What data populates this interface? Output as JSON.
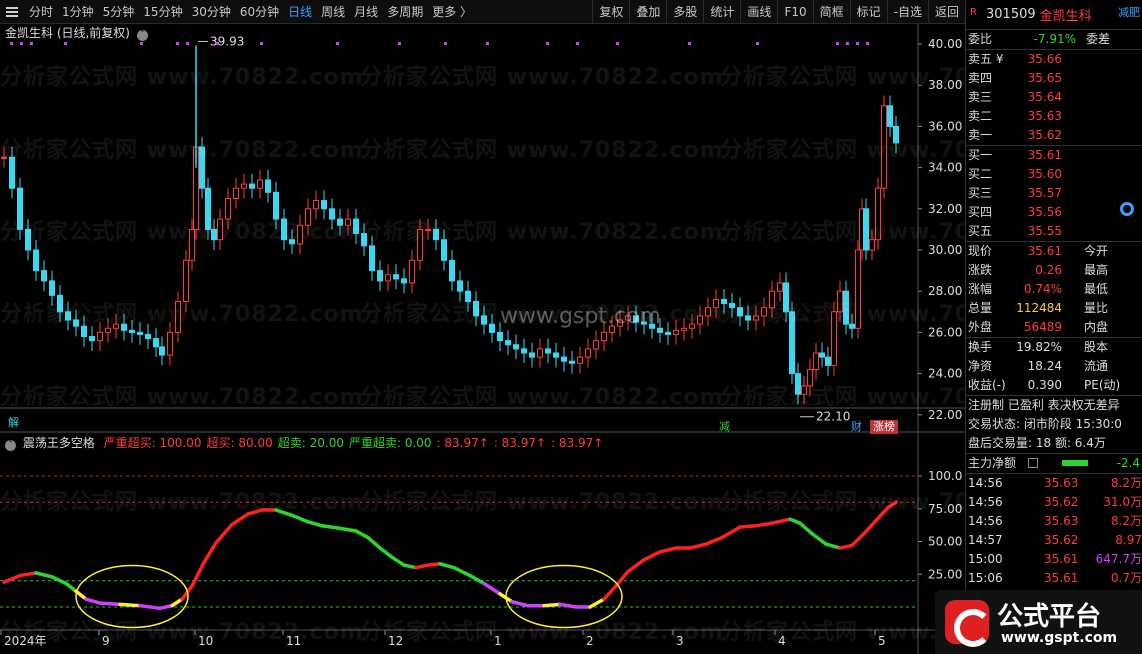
{
  "toolbar": {
    "periods": [
      "分时",
      "1分钟",
      "5分钟",
      "15分钟",
      "30分钟",
      "60分钟",
      "日线",
      "周线",
      "月线",
      "多周期",
      "更多 〉"
    ],
    "active_period": "日线",
    "actions": [
      "复权",
      "叠加",
      "多股",
      "统计",
      "画线",
      "F10",
      "简框",
      "标记",
      "-自选",
      "返回"
    ]
  },
  "main_chart": {
    "title": "金凯生科 (日线,前复权)",
    "y_ticks": [
      "40.00",
      "38.00",
      "36.00",
      "34.00",
      "32.00",
      "30.00",
      "28.00",
      "26.00",
      "24.00",
      "22.00"
    ],
    "high_label": "39.93",
    "low_label": "22.10",
    "badges": {
      "jie": "解",
      "jian": "减",
      "cai": "财",
      "zhangbang": "涨榜"
    }
  },
  "watermark": {
    "repeat_text": "分析家公式网 www.70822.com",
    "center_text": "www.gspt.com"
  },
  "oscillator": {
    "title": "震荡王多空格",
    "params": [
      {
        "label": "严重超买: 100.00",
        "color": "#ff3b3b"
      },
      {
        "label": "超买: 80.00",
        "color": "#ff3b3b"
      },
      {
        "label": "超卖: 20.00",
        "color": "#2fd52f"
      },
      {
        "label": "严重超卖: 0.00",
        "color": "#2fd52f"
      },
      {
        "label": ": 83.97↑",
        "color": "#ff3b3b"
      },
      {
        "label": ": 83.97↑",
        "color": "#ff3b3b"
      },
      {
        "label": ": 83.97↑",
        "color": "#ff3b3b"
      }
    ],
    "y_ticks": [
      "100.0",
      "75.00",
      "50.00",
      "25.00"
    ]
  },
  "x_axis": {
    "labels": [
      "2024年",
      "9",
      "10",
      "11",
      "12",
      "1",
      "2",
      "3",
      "4",
      "5"
    ]
  },
  "panel": {
    "code": "301509",
    "name": "金凯生科",
    "r_tag": "R",
    "corner_tag": "减肥",
    "webi": {
      "label": "委比",
      "value": "-7.91%",
      "label2": "委差"
    },
    "asks": [
      {
        "label": "卖五 ¥",
        "price": "35.66"
      },
      {
        "label": "卖四",
        "price": "35.65"
      },
      {
        "label": "卖三",
        "price": "35.64"
      },
      {
        "label": "卖二",
        "price": "35.63"
      },
      {
        "label": "卖一",
        "price": "35.62"
      }
    ],
    "bids": [
      {
        "label": "买一",
        "price": "35.61"
      },
      {
        "label": "买二",
        "price": "35.60"
      },
      {
        "label": "买三",
        "price": "35.57"
      },
      {
        "label": "买四",
        "price": "35.56"
      },
      {
        "label": "买五",
        "price": "35.55"
      }
    ],
    "quote": [
      {
        "k": "现价",
        "v": "35.61",
        "c": "#ff3b3b",
        "k2": "今开"
      },
      {
        "k": "涨跌",
        "v": "0.26",
        "c": "#ff3b3b",
        "k2": "最高"
      },
      {
        "k": "涨幅",
        "v": "0.74%",
        "c": "#ff3b3b",
        "k2": "最低"
      },
      {
        "k": "总量",
        "v": "112484",
        "c": "#ffcc33",
        "k2": "量比"
      },
      {
        "k": "外盘",
        "v": "56489",
        "c": "#ff3b3b",
        "k2": "内盘"
      }
    ],
    "stats": [
      {
        "k": "换手",
        "v": "19.82%",
        "k2": "股本"
      },
      {
        "k": "净资",
        "v": "18.24",
        "k2": "流通"
      },
      {
        "k": "收益(-)",
        "v": "0.390",
        "k2": "PE(动)"
      }
    ],
    "reg_line": "注册制 已盈利 表决权无差异",
    "trade_status": "交易状态: 闭市阶段 15:30:0",
    "after_hours": "盘后交易量: 18  额: 6.4万",
    "net_flow": {
      "label": "主力净额",
      "value": "-2.4"
    },
    "ticks": [
      {
        "t": "14:56",
        "p": "35.63",
        "v": "8.2万",
        "vc": "#ff3b3b"
      },
      {
        "t": "14:56",
        "p": "35.62",
        "v": "31.0万",
        "vc": "#ff3b3b"
      },
      {
        "t": "14:56",
        "p": "35.63",
        "v": "8.2万",
        "vc": "#ff3b3b"
      },
      {
        "t": "14:57",
        "p": "35.62",
        "v": "8.97",
        "vc": "#ff3b3b"
      },
      {
        "t": "15:00",
        "p": "35.61",
        "v": "647.7万",
        "vc": "#d040ff"
      },
      {
        "t": "15:06",
        "p": "35.61",
        "v": "0.7万",
        "vc": "#ff3b3b"
      }
    ]
  },
  "logo": {
    "text": "公式平台",
    "url": "www.gspt.com"
  },
  "colors": {
    "up": "#ff3b3b",
    "down": "#3ad8f0",
    "accent": "#3aa0ff",
    "osc_up": "#ff2020",
    "osc_down": "#2fd52f",
    "osc_low": "#d040ff"
  }
}
